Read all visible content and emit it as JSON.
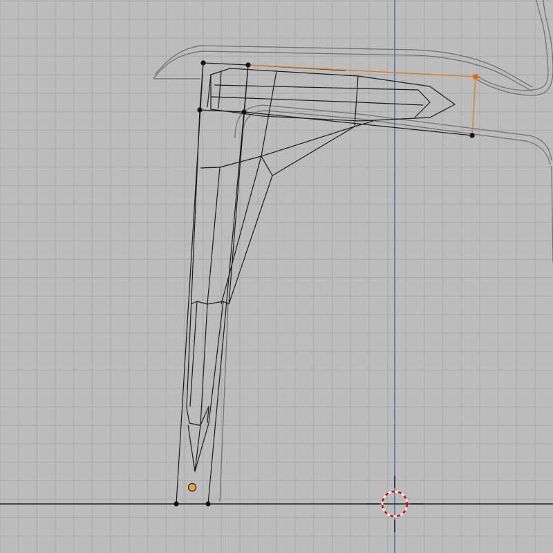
{
  "viewport": {
    "view": "orthographic-side",
    "mode": "edit-mode-wireframe",
    "colors": {
      "background": "#bcbcbc",
      "grid": "#a8a8a8",
      "mesh_wire": "#1a1a1a",
      "reference_wire": "#6e6e6e",
      "selection": "#e07b1a",
      "z_axis": "#2c5aa0",
      "horizon": "#000000",
      "cursor_red": "#d40000"
    },
    "icons": [
      "3d-cursor-icon",
      "object-origin-icon"
    ],
    "selected_vertices": 1
  }
}
